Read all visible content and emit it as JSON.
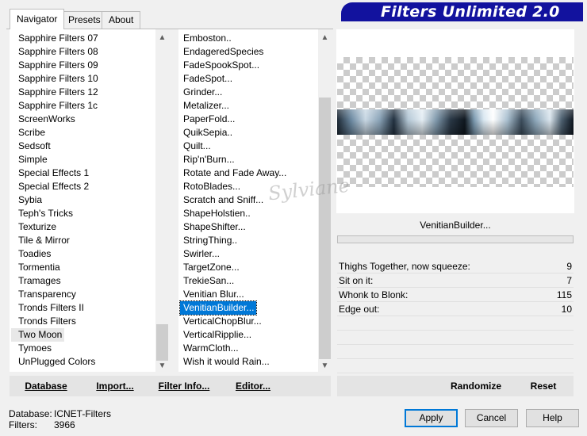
{
  "tabs": [
    {
      "label": "Navigator",
      "active": true
    },
    {
      "label": "Presets",
      "active": false
    },
    {
      "label": "About",
      "active": false
    }
  ],
  "banner": {
    "title": "Filters Unlimited 2.0",
    "color": "#12129e"
  },
  "categories": [
    "Sapphire Filters 07",
    "Sapphire Filters 08",
    "Sapphire Filters 09",
    "Sapphire Filters 10",
    "Sapphire Filters 12",
    "Sapphire Filters 1c",
    "ScreenWorks",
    "Scribe",
    "Sedsoft",
    "Simple",
    "Special Effects 1",
    "Special Effects 2",
    "Sybia",
    "Teph's Tricks",
    "Texturize",
    "Tile & Mirror",
    "Toadies",
    "Tormentia",
    "Tramages",
    "Transparency",
    "Tronds Filters II",
    "Tronds Filters",
    "Two Moon",
    "Tymoes",
    "UnPlugged Colors"
  ],
  "categories_selected": "Two Moon",
  "filters": [
    "Emboston..",
    "EndageredSpecies",
    "FadeSpookSpot...",
    "FadeSpot...",
    "Grinder...",
    "Metalizer...",
    "PaperFold...",
    "QuikSepia..",
    "Quilt...",
    "Rip'n'Burn...",
    "Rotate and Fade Away...",
    "RotoBlades...",
    "Scratch and Sniff...",
    "ShapeHolstien..",
    "ShapeShifter...",
    "StringThing..",
    "Swirler...",
    "TargetZone...",
    "TrekieSan...",
    "Venitian Blur...",
    "VenitianBuilder...",
    "VerticalChopBlur...",
    "VerticalRipplie...",
    "WarmCloth...",
    "Wish it would Rain..."
  ],
  "filters_selected": "VenitianBuilder...",
  "watermark": "Sylviane",
  "filter_title": "VenitianBuilder...",
  "params": [
    {
      "label": "Thighs Together, now squeeze:",
      "value": "9"
    },
    {
      "label": "Sit on it:",
      "value": "7"
    },
    {
      "label": "Whonk to Blonk:",
      "value": "115"
    },
    {
      "label": "Edge out:",
      "value": "10"
    }
  ],
  "toolbar": {
    "database": "Database",
    "import": "Import...",
    "filter_info": "Filter Info...",
    "editor": "Editor...",
    "randomize": "Randomize",
    "reset": "Reset"
  },
  "status": {
    "database_label": "Database:",
    "database_value": "ICNET-Filters",
    "filters_label": "Filters:",
    "filters_value": "3966"
  },
  "dialog_buttons": {
    "apply": "Apply",
    "cancel": "Cancel",
    "help": "Help"
  }
}
